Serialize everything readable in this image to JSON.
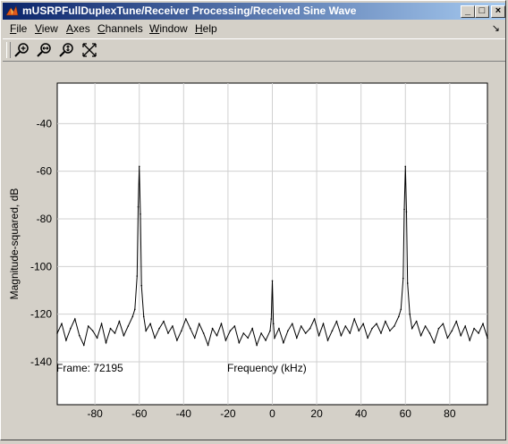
{
  "window": {
    "title": "mUSRPFullDuplexTune/Receiver Processing/Received Sine Wave",
    "controls": {
      "minimize": "_",
      "maximize": "□",
      "close": "×"
    }
  },
  "menu": {
    "items": [
      {
        "key": "F",
        "rest": "ile"
      },
      {
        "key": "V",
        "rest": "iew"
      },
      {
        "key": "A",
        "rest": "xes"
      },
      {
        "key": "C",
        "rest": "hannels"
      },
      {
        "key": "W",
        "rest": "indow"
      },
      {
        "key": "H",
        "rest": "elp"
      }
    ],
    "dock_glyph": "↘"
  },
  "toolbar": {
    "tools": [
      "zoom-in-icon",
      "zoom-x-icon",
      "zoom-y-icon",
      "autoscale-icon"
    ]
  },
  "status": {
    "frame": "Frame: 72195"
  },
  "chart_data": {
    "type": "line",
    "xlabel": "Frequency (kHz)",
    "ylabel": "Magnitude-squared, dB",
    "xlim": [
      -97,
      97
    ],
    "ylim": [
      -158,
      -23
    ],
    "xticks": [
      -80,
      -60,
      -40,
      -20,
      0,
      20,
      40,
      60,
      80
    ],
    "xtick_labels": [
      "-80",
      "-60",
      "-40",
      "-20",
      "0",
      "20",
      "40",
      "60",
      "80"
    ],
    "yticks": [
      -140,
      -120,
      -100,
      -80,
      -60,
      -40
    ],
    "ytick_labels": [
      "-140",
      "-120",
      "-100",
      "-80",
      "-60",
      "-40"
    ],
    "grid": true,
    "series": [
      {
        "x": [
          -97,
          -95,
          -93,
          -91,
          -89,
          -87,
          -85,
          -83,
          -81,
          -79,
          -77,
          -75,
          -73,
          -71,
          -69,
          -67,
          -65,
          -63,
          -62,
          -61,
          -60.5,
          -60,
          -59.5,
          -59,
          -58,
          -57,
          -55,
          -53,
          -51,
          -49,
          -47,
          -45,
          -43,
          -41,
          -39,
          -37,
          -35,
          -33,
          -31,
          -29,
          -27,
          -25,
          -23,
          -21,
          -19,
          -17,
          -15,
          -13,
          -11,
          -9,
          -7,
          -5,
          -3,
          -1,
          -0.5,
          0,
          0.5,
          1,
          3,
          5,
          7,
          9,
          11,
          13,
          15,
          17,
          19,
          21,
          23,
          25,
          27,
          29,
          31,
          33,
          35,
          37,
          39,
          41,
          43,
          45,
          47,
          49,
          51,
          53,
          55,
          57,
          58,
          59,
          59.5,
          60,
          60.5,
          61,
          62,
          63,
          65,
          67,
          69,
          71,
          73,
          75,
          77,
          79,
          81,
          83,
          85,
          87,
          89,
          91,
          93,
          95,
          97
        ],
        "y": [
          -128,
          -124,
          -131,
          -126,
          -122,
          -129,
          -133,
          -125,
          -127,
          -130,
          -124,
          -132,
          -126,
          -128,
          -123,
          -129,
          -125,
          -121,
          -118,
          -104,
          -75,
          -58,
          -78,
          -108,
          -121,
          -127,
          -124,
          -130,
          -126,
          -123,
          -128,
          -125,
          -131,
          -127,
          -122,
          -126,
          -130,
          -124,
          -128,
          -133,
          -126,
          -129,
          -124,
          -131,
          -127,
          -125,
          -132,
          -128,
          -130,
          -126,
          -133,
          -128,
          -131,
          -127,
          -122,
          -106,
          -124,
          -130,
          -126,
          -132,
          -127,
          -124,
          -130,
          -125,
          -128,
          -126,
          -122,
          -129,
          -124,
          -131,
          -127,
          -123,
          -129,
          -125,
          -128,
          -122,
          -127,
          -124,
          -130,
          -126,
          -124,
          -128,
          -123,
          -127,
          -125,
          -121,
          -118,
          -105,
          -76,
          -58,
          -77,
          -107,
          -120,
          -126,
          -123,
          -129,
          -125,
          -128,
          -132,
          -126,
          -124,
          -130,
          -127,
          -123,
          -129,
          -125,
          -131,
          -126,
          -128,
          -124,
          -130
        ]
      }
    ]
  }
}
